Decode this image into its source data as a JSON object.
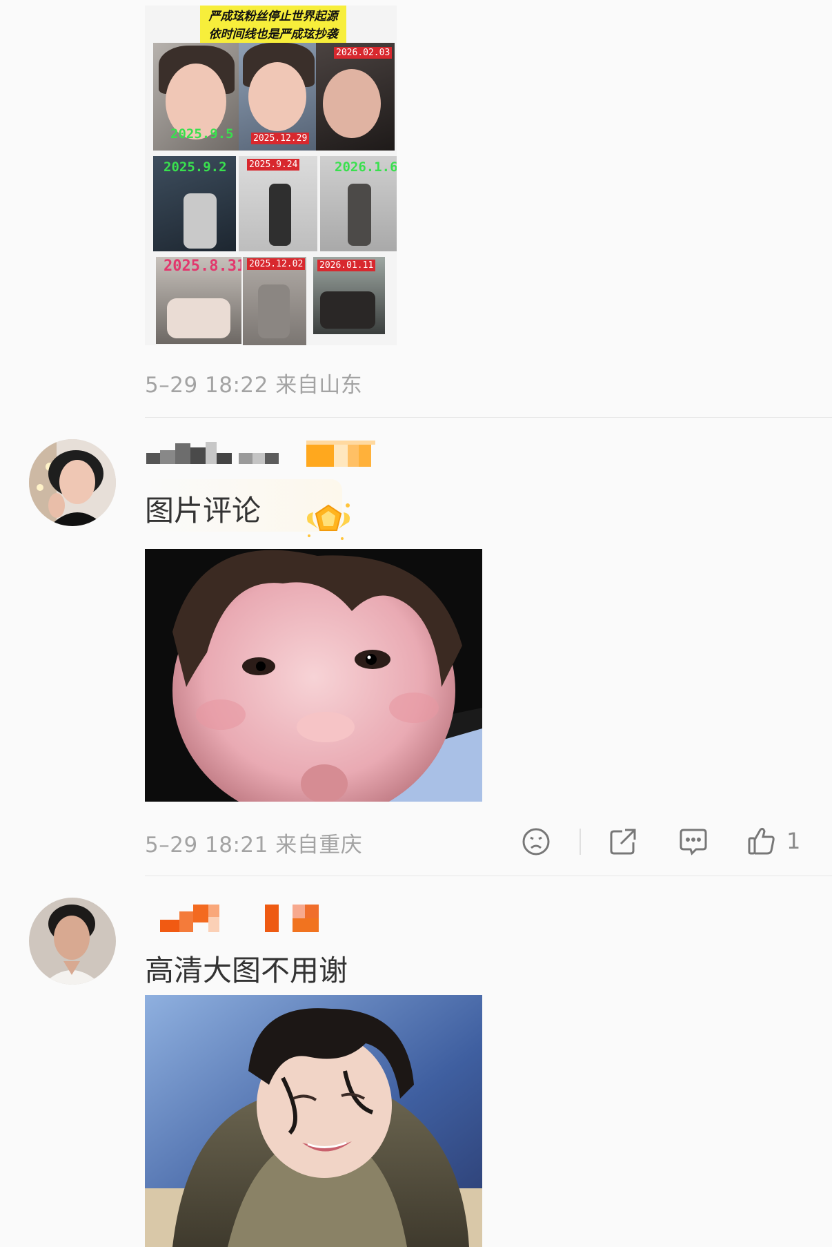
{
  "post": {
    "collage_caption_line1": "严成玹粉丝停止世界起源",
    "collage_caption_line2": "依时间线也是严成玹抄袭",
    "collage_dates": [
      "2026.02.03",
      "2025.9.5",
      "2025.12.29",
      "2025.9.2",
      "2025.9.24",
      "2026.1.6",
      "2025.8.31",
      "2025.12.02",
      "2026.01.11"
    ],
    "meta": "5–29 18:22  来自山东"
  },
  "comments": [
    {
      "text": "图片评论",
      "meta": "5–29 18:21  来自重庆",
      "like_count": "1"
    },
    {
      "text": "高清大图不用谢"
    }
  ],
  "icons": {
    "dislike": "sad-face-icon",
    "share": "share-icon",
    "reply": "comment-bubble-icon",
    "like": "thumbs-up-icon",
    "badge": "gold-badge-icon"
  }
}
